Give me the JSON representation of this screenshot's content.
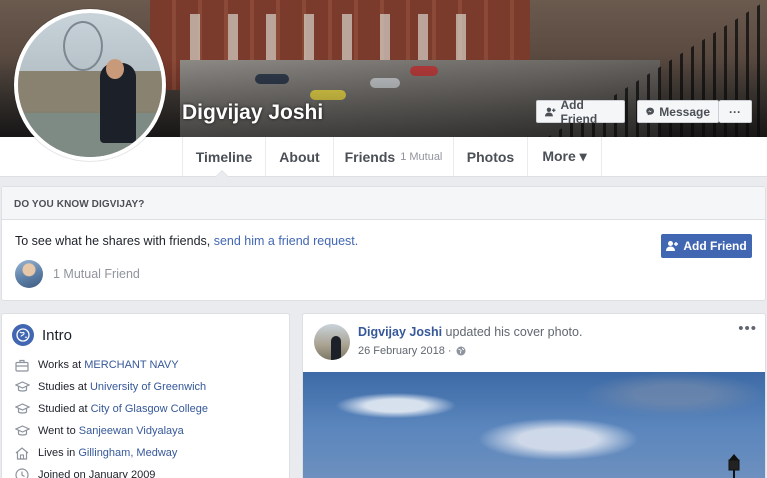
{
  "profile": {
    "name": "Digvijay Joshi"
  },
  "cover_actions": {
    "add_friend": "Add Friend",
    "message": "Message",
    "more": "···"
  },
  "tabs": [
    {
      "label": "Timeline"
    },
    {
      "label": "About"
    },
    {
      "label": "Friends",
      "badge": "1 Mutual"
    },
    {
      "label": "Photos"
    },
    {
      "label": "More ▾"
    }
  ],
  "know_card": {
    "heading": "DO YOU KNOW DIGVIJAY?",
    "text_prefix": "To see what he shares with friends, ",
    "link": "send him a friend request.",
    "add_friend": "Add Friend",
    "mutual_friends": "1 Mutual Friend"
  },
  "intro": {
    "title": "Intro",
    "items": [
      {
        "icon": "briefcase-icon",
        "prefix": "Works at ",
        "link": "MERCHANT NAVY"
      },
      {
        "icon": "graduation-cap-icon",
        "prefix": "Studies at ",
        "link": "University of Greenwich"
      },
      {
        "icon": "graduation-cap-icon",
        "prefix": "Studied at ",
        "link": "City of Glasgow College"
      },
      {
        "icon": "graduation-cap-icon",
        "prefix": "Went to ",
        "link": "Sanjeewan Vidyalaya"
      },
      {
        "icon": "home-icon",
        "prefix": "Lives in ",
        "link": "Gillingham, Medway"
      },
      {
        "icon": "clock-icon",
        "prefix": "Joined on January 2009",
        "link": ""
      }
    ]
  },
  "post": {
    "author": "Digvijay Joshi",
    "action": " updated his cover photo.",
    "date": "26 February 2018 ·",
    "more": "•••"
  },
  "colors": {
    "brand_blue": "#4267b2",
    "link_blue": "#365899",
    "background": "#e9ebee"
  }
}
